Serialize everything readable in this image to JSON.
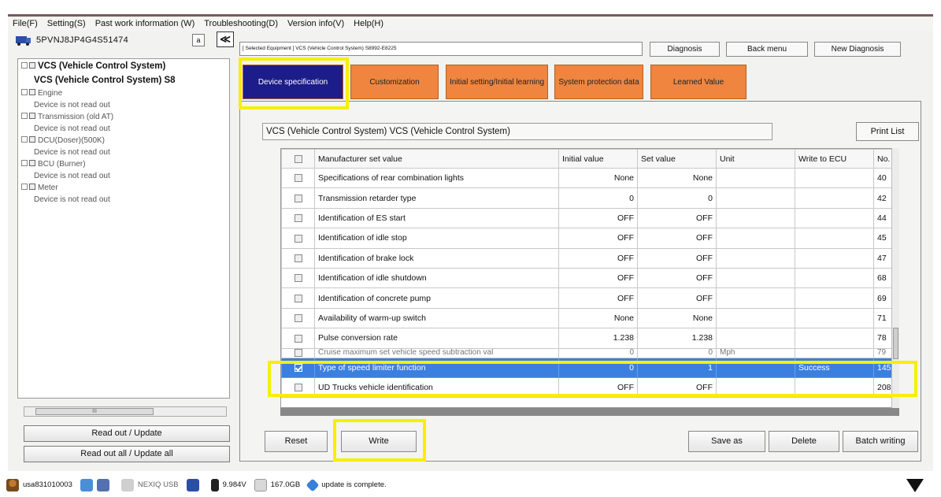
{
  "menu": [
    "File(F)",
    "Setting(S)",
    "Past work information (W)",
    "Troubleshooting(D)",
    "Version info(V)",
    "Help(H)"
  ],
  "vehicle": {
    "vin": "5PVNJ8JP4G4S51474",
    "small_btn": "a",
    "collapse_btn": "≪"
  },
  "selected_equipment": "[ Selected Equipment ] VCS (Vehicle Control System) S8992-E8225",
  "top_buttons": {
    "diagnosis": "Diagnosis",
    "back_menu": "Back menu",
    "new_diagnosis": "New Diagnosis"
  },
  "tree": {
    "root_bold": "VCS (Vehicle Control System)",
    "child_bold": "VCS (Vehicle Control System) S8",
    "items": [
      {
        "label": "Engine",
        "child": "Device is not read out"
      },
      {
        "label": "Transmission (old AT)",
        "child": "Device is not read out"
      },
      {
        "label": "DCU(Doser)(500K)",
        "child": "Device is not read out"
      },
      {
        "label": "BCU (Burner)",
        "child": "Device is not read out"
      },
      {
        "label": "Meter",
        "child": "Device is not read out"
      }
    ],
    "scroll_label": "III"
  },
  "left_buttons": {
    "read_out": "Read out / Update",
    "read_all": "Read out all / Update all"
  },
  "tabs": [
    {
      "label": "Device specification",
      "active": true
    },
    {
      "label": "Customization",
      "active": false
    },
    {
      "label": "Initial setting/Initial learning",
      "active": false
    },
    {
      "label": "System protection data",
      "active": false
    },
    {
      "label": "Learned Value",
      "active": false
    }
  ],
  "panel_title": "VCS (Vehicle Control System) VCS (Vehicle Control System)",
  "print_list": "Print List",
  "table": {
    "headers": [
      "",
      "Manufacturer set value",
      "Initial value",
      "Set value",
      "Unit",
      "Write to ECU",
      "No."
    ],
    "rows": [
      {
        "name": "Specifications of rear combination lights",
        "initial": "None",
        "set": "None",
        "unit": "",
        "write": "",
        "no": "40"
      },
      {
        "name": "Transmission retarder type",
        "initial": "0",
        "set": "0",
        "unit": "",
        "write": "",
        "no": "42"
      },
      {
        "name": "Identification of ES start",
        "initial": "OFF",
        "set": "OFF",
        "unit": "",
        "write": "",
        "no": "44"
      },
      {
        "name": "Identification of idle stop",
        "initial": "OFF",
        "set": "OFF",
        "unit": "",
        "write": "",
        "no": "45"
      },
      {
        "name": "Identification of brake lock",
        "initial": "OFF",
        "set": "OFF",
        "unit": "",
        "write": "",
        "no": "47"
      },
      {
        "name": "Identification of idle shutdown",
        "initial": "OFF",
        "set": "OFF",
        "unit": "",
        "write": "",
        "no": "68"
      },
      {
        "name": "Identification of concrete pump",
        "initial": "OFF",
        "set": "OFF",
        "unit": "",
        "write": "",
        "no": "69"
      },
      {
        "name": "Availability of warm-up switch",
        "initial": "None",
        "set": "None",
        "unit": "",
        "write": "",
        "no": "71"
      },
      {
        "name": "Pulse conversion rate",
        "initial": "1.238",
        "set": "1.238",
        "unit": "",
        "write": "",
        "no": "78"
      }
    ],
    "partial_row": {
      "name": "Cruise maximum set vehicle speed subtraction val",
      "initial": "0",
      "set": "0",
      "unit": "Mph",
      "write": "",
      "no": "79"
    },
    "selected_row": {
      "name": "Type of speed limiter function",
      "initial": "0",
      "set": "1",
      "unit": "",
      "write": "Success",
      "no": "145"
    },
    "last_row": {
      "name": "UD Trucks vehicle identification",
      "initial": "OFF",
      "set": "OFF",
      "unit": "",
      "write": "",
      "no": "208"
    }
  },
  "bottom_buttons": {
    "reset": "Reset",
    "write": "Write",
    "save_as": "Save as",
    "delete": "Delete",
    "batch": "Batch writing"
  },
  "status": {
    "user": "usa831010003",
    "nexiq": "NEXIQ USB",
    "voltage": "9.984V",
    "disk": "167.0GB",
    "message": "update is complete."
  },
  "colors": {
    "active_tab": "#1c1c8a",
    "tab": "#f08540",
    "selected_row": "#3b7fe0",
    "highlight": "#f6f000"
  }
}
